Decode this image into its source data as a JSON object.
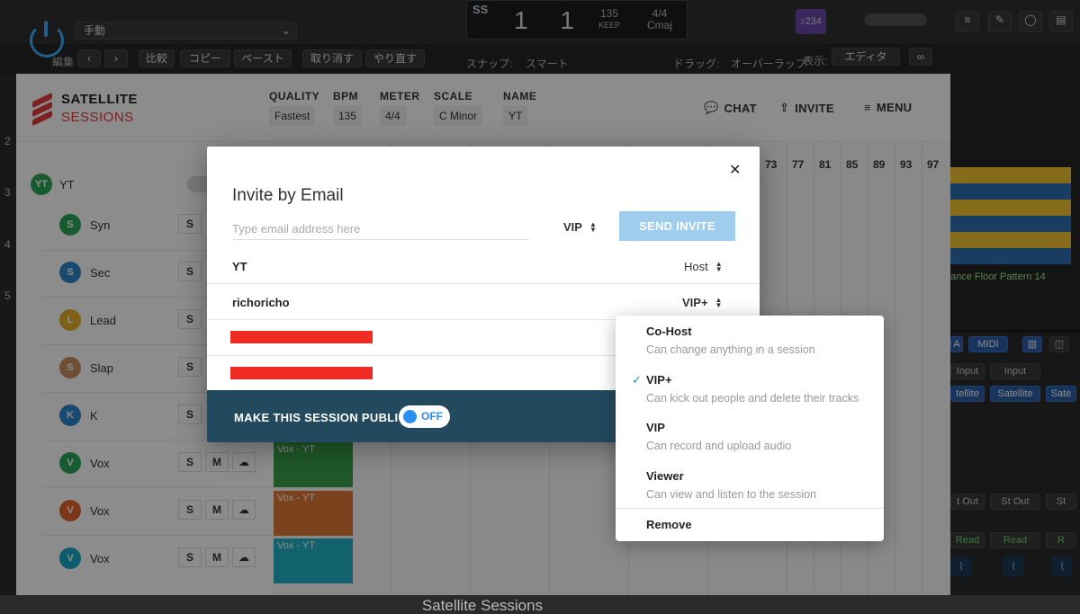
{
  "daw": {
    "mode": "手動",
    "compare": "比較",
    "copy": "コピー",
    "paste": "ペースト",
    "undo": "取り消す",
    "redo": "やり直す",
    "snap_label": "スナップ:",
    "snap_value": "スマート",
    "drag_label": "ドラッグ:",
    "drag_value": "オーバーラップ",
    "view_label": "表示:",
    "view_value": "エディタ",
    "lcd_ss": "SS",
    "lcd_bars": "1  1",
    "lcd_tempo": "135",
    "lcd_tempo_label": "KEEP",
    "lcd_sig": "4/4",
    "lcd_key": "Cmaj",
    "purple_badge": "♪234",
    "edit_menu": "編集",
    "pattern_label": "ance Floor Pattern 14",
    "mixer": {
      "midi": "MIDI",
      "a": "A",
      "input1": "Input",
      "input2": "Input",
      "sat1": "tellite",
      "sat2": "Satellite",
      "sat3": "Sate",
      "out1": "t Out",
      "out2": "St Out",
      "out3": "St",
      "read1": "Read",
      "read2": "Read",
      "read3": "R"
    },
    "ruler_numbers": [
      "2",
      "3",
      "4",
      "5"
    ],
    "bottom_title": "Satellite Sessions"
  },
  "app": {
    "logo_top": "SATELLITE",
    "logo_bottom": "SESSIONS",
    "header": {
      "quality_label": "QUALITY",
      "quality_value": "Fastest",
      "bpm_label": "BPM",
      "bpm_value": "135",
      "meter_label": "METER",
      "meter_value": "4/4",
      "scale_label": "SCALE",
      "scale_value": "C Minor",
      "name_label": "NAME",
      "name_value": "YT",
      "chat": "CHAT",
      "invite": "INVITE",
      "menu": "MENU"
    },
    "group": {
      "initials": "YT",
      "name": "YT"
    },
    "tracks": [
      {
        "initial": "S",
        "name": "Syn",
        "color": "#2fa65a"
      },
      {
        "initial": "S",
        "name": "Sec",
        "color": "#2f86c9"
      },
      {
        "initial": "L",
        "name": "Lead",
        "color": "#e6b12a"
      },
      {
        "initial": "S",
        "name": "Slap",
        "color": "#c98f5f"
      },
      {
        "initial": "K",
        "name": "K",
        "color": "#2f86c9"
      },
      {
        "initial": "V",
        "name": "Vox",
        "color": "#2fa65a"
      },
      {
        "initial": "V",
        "name": "Vox",
        "color": "#e0642a"
      },
      {
        "initial": "V",
        "name": "Vox",
        "color": "#18a8c4"
      }
    ],
    "btn_s": "S",
    "btn_m": "M",
    "bar_numbers": [
      "73",
      "77",
      "81",
      "85",
      "89",
      "93",
      "97"
    ],
    "clips": [
      {
        "label": "Vox - YT",
        "color": "#3a9e4a"
      },
      {
        "label": "Vox - YT",
        "color": "#e07a35"
      },
      {
        "label": "Vox - YT",
        "color": "#22b3c9"
      }
    ]
  },
  "modal": {
    "title": "Invite by Email",
    "email_placeholder": "Type email address here",
    "invite_role": "VIP",
    "send_label": "SEND INVITE",
    "members": [
      {
        "name": "YT",
        "role": "Host"
      },
      {
        "name": "richoricho",
        "role": "VIP+"
      }
    ],
    "public_label": "MAKE THIS SESSION PUBLIC",
    "public_toggle": "OFF"
  },
  "dropdown": {
    "options": [
      {
        "title": "Co-Host",
        "desc": "Can change anything in a session",
        "selected": false
      },
      {
        "title": "VIP+",
        "desc": "Can kick out people and delete their tracks",
        "selected": true
      },
      {
        "title": "VIP",
        "desc": "Can record and upload audio",
        "selected": false
      },
      {
        "title": "Viewer",
        "desc": "Can view and listen to the session",
        "selected": false
      }
    ],
    "remove": "Remove",
    "check": "✓"
  },
  "colors": {
    "accent_blue": "#2f8ff0",
    "send_button": "#9ecdee",
    "public_bar": "#23495e",
    "redaction": "#f02b24",
    "brand_red": "#e53b3b"
  }
}
